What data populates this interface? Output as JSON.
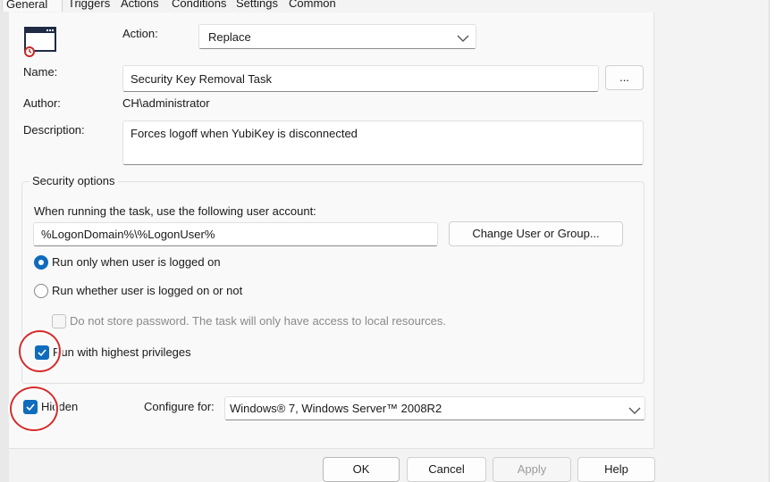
{
  "tabs": [
    "General",
    "Triggers",
    "Actions",
    "Conditions",
    "Settings",
    "Common"
  ],
  "action": {
    "label": "Action:",
    "value": "Replace"
  },
  "name": {
    "label": "Name:",
    "value": "Security Key Removal Task",
    "browse_label": "..."
  },
  "author": {
    "label": "Author:",
    "value": "CH\\administrator"
  },
  "description": {
    "label": "Description:",
    "value": "Forces logoff when YubiKey is disconnected"
  },
  "security": {
    "title": "Security options",
    "account_prompt": "When running the task, use the following user account:",
    "account_value": "%LogonDomain%\\%LogonUser%",
    "change_button": "Change User or Group...",
    "radio_logged_on": "Run only when user is logged on",
    "radio_whether": "Run whether user is logged on or not",
    "no_store_password": "Do not store password. The task will only have access to local resources.",
    "highest_privileges": "Run with highest privileges"
  },
  "hidden": {
    "label": "Hidden"
  },
  "configure": {
    "label": "Configure for:",
    "value": "Windows® 7, Windows Server™ 2008R2"
  },
  "buttons": {
    "ok": "OK",
    "cancel": "Cancel",
    "apply": "Apply",
    "help": "Help"
  },
  "colors": {
    "accent": "#0f6cbd",
    "annotation": "#d62d2d"
  }
}
